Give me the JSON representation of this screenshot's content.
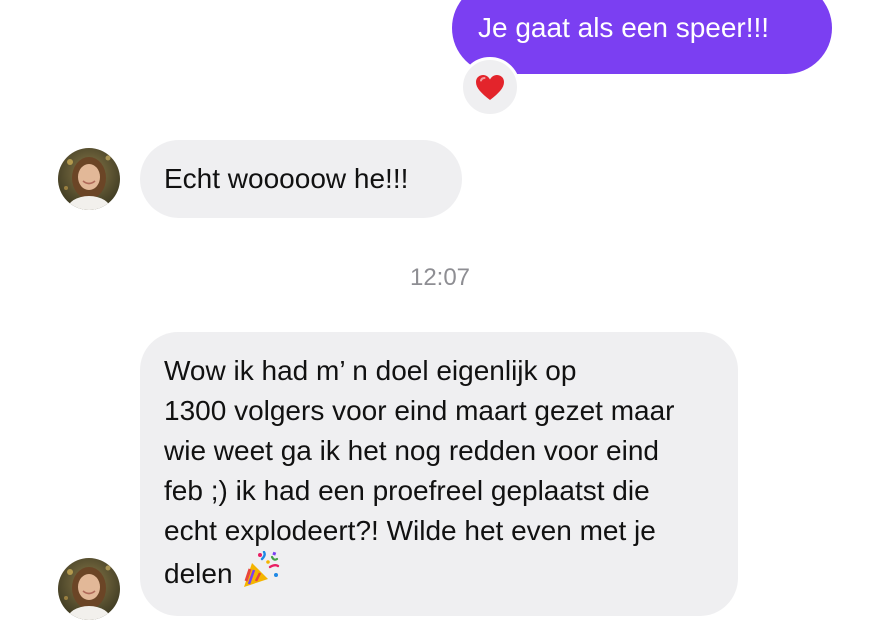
{
  "conversation": {
    "outgoing_message": {
      "text": "Je gaat als een speer!!!",
      "reaction": "heart-emoji"
    },
    "incoming_message_1": {
      "text": "Echt wooooow he!!!",
      "avatar": "contact-avatar"
    },
    "timestamp": "12:07",
    "incoming_message_2": {
      "lines": [
        "Wow ik had m’ n doel eigenlijk op",
        "1300 volgers voor eind maart gezet maar",
        "wie weet ga ik het nog redden voor eind",
        "feb ;) ik had een proefreel geplaatst die",
        "echt explodeert?! Wilde het even met je",
        "delen"
      ],
      "trailing_emoji": "party-popper-emoji",
      "avatar": "contact-avatar"
    }
  },
  "colors": {
    "outgoing_bubble": "#7b3ff2",
    "incoming_bubble": "#efeff1",
    "timestamp_text": "#8e8e93",
    "background": "#ffffff"
  }
}
